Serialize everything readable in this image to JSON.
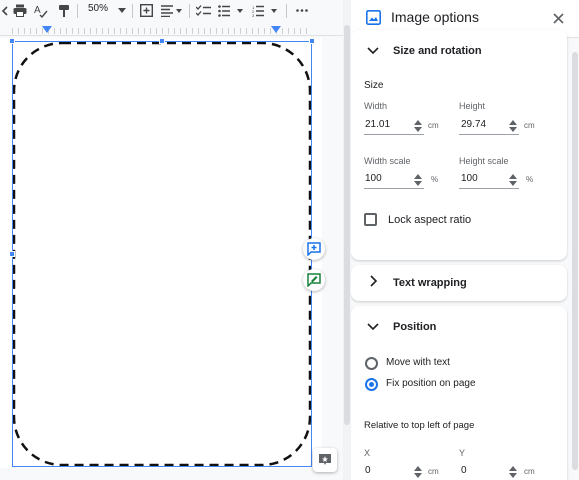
{
  "toolbar": {
    "zoom_value": "50%",
    "icons": [
      "undo-icon",
      "print-icon",
      "spellcheck-icon",
      "paint-format-icon",
      "zoom-dropdown-icon",
      "add-comment-icon",
      "align-icon",
      "checklist-icon",
      "bulleted-list-icon",
      "numbered-list-icon",
      "more-options-icon"
    ]
  },
  "panel": {
    "title": "Image options",
    "size_rotation": {
      "heading": "Size and rotation",
      "size_label": "Size",
      "width_label": "Width",
      "width_value": "21.01",
      "width_unit": "cm",
      "height_label": "Height",
      "height_value": "29.74",
      "height_unit": "cm",
      "width_scale_label": "Width scale",
      "width_scale_value": "100",
      "width_scale_unit": "%",
      "height_scale_label": "Height scale",
      "height_scale_value": "100",
      "height_scale_unit": "%",
      "lock_label": "Lock aspect ratio",
      "lock_checked": false
    },
    "text_wrapping": {
      "heading": "Text wrapping"
    },
    "position": {
      "heading": "Position",
      "option_move": "Move with text",
      "option_fix": "Fix position on page",
      "selected": "Fix position on page",
      "relative_label": "Relative to top left of page",
      "x_label": "X",
      "x_value": "0",
      "x_unit": "cm",
      "y_label": "Y",
      "y_value": "0",
      "y_unit": "cm"
    }
  },
  "colors": {
    "accent": "#1a73e8",
    "selection": "#4285f4",
    "comment_icon": "#1a73e8",
    "suggest_icon": "#188038"
  }
}
